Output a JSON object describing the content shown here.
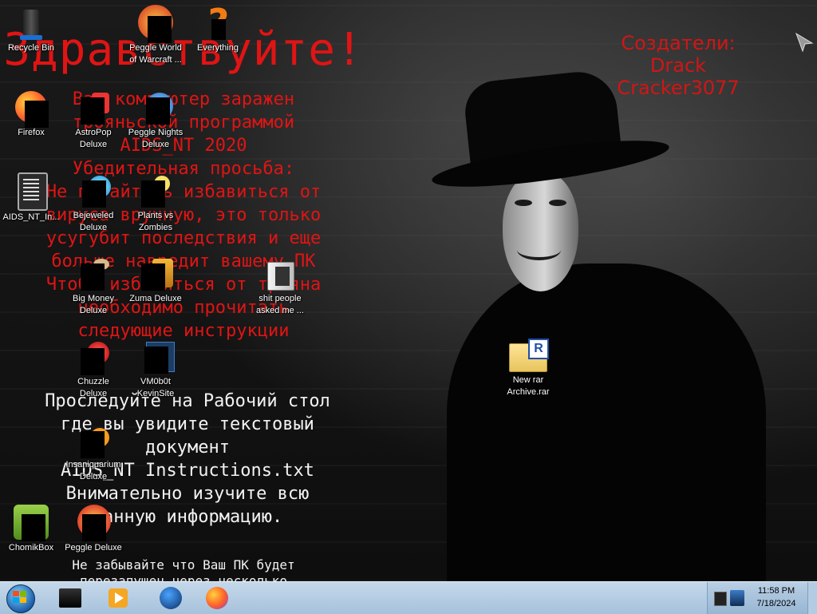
{
  "desktop": {
    "greeting": "Здравствуйте!",
    "warning_lines": [
      "Ваш компьютер заражен",
      "трояньской программой",
      "AIDS_NT 2020",
      "Убедительная просьба:",
      "Не пытайтесь избавиться от",
      "вируса вручную, это только",
      "усугубит последствия и еще",
      "больше навредит вашему ПК",
      "Чтобы избавиться от трояна",
      "необходимо прочитать",
      "следующие инструкции"
    ],
    "creators_lines": [
      "Создатели:",
      "Drack",
      "Cracker3077"
    ],
    "instruction_lines": [
      "Проследуйте на Рабочий стол",
      "где вы увидите текстовый",
      "документ",
      "AIDS_NT Instructions.txt",
      "Внимательно изучите всю",
      "данную информацию."
    ],
    "reminder_lines": [
      "Не забывайте что Ваш ПК будет",
      "перезапущен через несколько"
    ],
    "icons": [
      {
        "label": "Recycle Bin",
        "icon": "recycle-bin-icon"
      },
      {
        "label": "Peggle World of Warcraft ...",
        "icon": "peggle-wow-icon"
      },
      {
        "label": "Everything",
        "icon": "everything-icon"
      },
      {
        "label": "Firefox",
        "icon": "firefox-icon"
      },
      {
        "label": "AstroPop Deluxe",
        "icon": "astropop-icon"
      },
      {
        "label": "Peggle Nights Deluxe",
        "icon": "peggle-nights-icon"
      },
      {
        "label": "AIDS_NT_In...",
        "icon": "text-document-icon"
      },
      {
        "label": "Bejeweled Deluxe",
        "icon": "bejeweled-icon"
      },
      {
        "label": "Plants vs Zombies",
        "icon": "plants-vs-zombies-icon"
      },
      {
        "label": "Big Money Deluxe",
        "icon": "big-money-icon"
      },
      {
        "label": "Zuma Deluxe",
        "icon": "zuma-icon"
      },
      {
        "label": "shit people asked me ...",
        "icon": "folder-icon"
      },
      {
        "label": "Chuzzle Deluxe",
        "icon": "chuzzle-icon"
      },
      {
        "label": "VM0b0t KevinSite",
        "icon": "vm0b0t-icon"
      },
      {
        "label": "New rar Archive.rar",
        "icon": "rar-archive-icon"
      },
      {
        "label": "Insaniquarium Deluxe",
        "icon": "insaniquarium-icon"
      },
      {
        "label": "ChomikBox",
        "icon": "chomikbox-icon"
      },
      {
        "label": "Peggle Deluxe",
        "icon": "peggle-deluxe-icon"
      }
    ]
  },
  "taskbar": {
    "pinned": [
      "taskbar-app-icon",
      "media-player-icon",
      "network-globe-icon",
      "firefox-icon"
    ],
    "clock_time": "11:58 PM",
    "clock_date": "7/18/2024"
  },
  "colors": {
    "warning_red": "#e01414",
    "taskbar": "#b3cce4"
  }
}
